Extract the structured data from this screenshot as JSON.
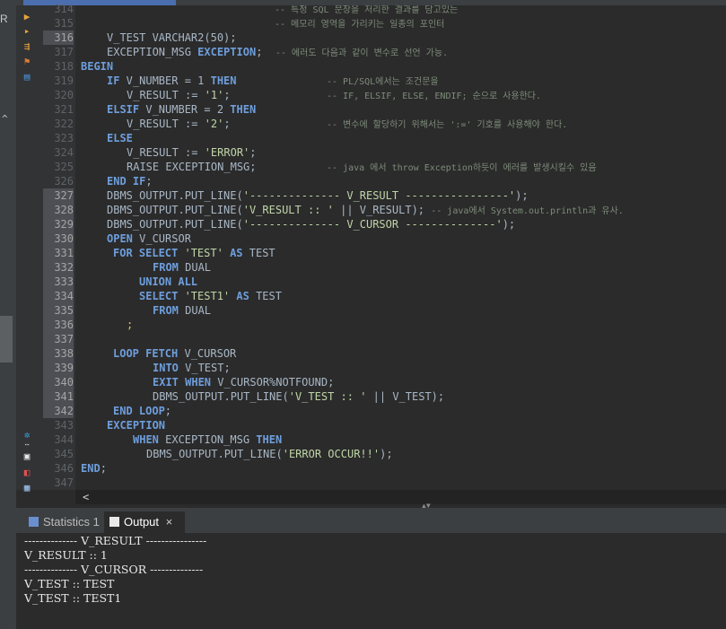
{
  "left_strip": {
    "label": "R"
  },
  "line_numbers": [
    "314",
    "315",
    "316",
    "317",
    "318",
    "319",
    "320",
    "321",
    "322",
    "323",
    "324",
    "325",
    "326",
    "327",
    "328",
    "329",
    "330",
    "331",
    "332",
    "333",
    "334",
    "335",
    "336",
    "337",
    "338",
    "339",
    "340",
    "341",
    "342",
    "343",
    "344",
    "345",
    "346",
    "347"
  ],
  "code": {
    "l314_c": "-- 특정 SQL 문장을 저리한 결과를 담고있는",
    "l315_c": "-- 메모리 영역을 가리키는 일종의 포인터",
    "l316_a": "V_TEST VARCHAR2(50);",
    "l317_a": "EXCEPTION_MSG ",
    "l317_k": "EXCEPTION",
    "l317_b": ";  ",
    "l317_c": "-- 에러도 다음과 같이 변수로 선언 가능.",
    "l318_k": "BEGIN",
    "l319_k1": "IF",
    "l319_a": " V_NUMBER = 1 ",
    "l319_k2": "THEN",
    "l319_c": "-- PL/SQL에서는 조건문을",
    "l320_a": "V_RESULT := ",
    "l320_s": "'1'",
    "l320_b": ";",
    "l320_c": "-- IF, ELSIF, ELSE, ENDIF; 순으로 사용한다.",
    "l321_k1": "ELSIF",
    "l321_a": " V_NUMBER = 2 ",
    "l321_k2": "THEN",
    "l322_a": "V_RESULT := ",
    "l322_s": "'2'",
    "l322_b": ";",
    "l322_c": "-- 변수에 할당하기 위해서는 ':=' 기호를 사용해야 한다.",
    "l323_k": "ELSE",
    "l324_a": "V_RESULT := ",
    "l324_s": "'ERROR'",
    "l324_b": ";",
    "l325_a": "RAISE EXCEPTION_MSG;",
    "l325_c": "-- java 에서 throw Exception하듯이 에러를 발생시킬수 있음",
    "l326_k": "END IF",
    "l326_b": ";",
    "l327_a": "DBMS_OUTPUT.PUT_LINE(",
    "l327_s": "'-------------- V_RESULT ----------------'",
    "l327_b": ");",
    "l328_a": "DBMS_OUTPUT.PUT_LINE(",
    "l328_s": "'V_RESULT :: '",
    "l328_b": " || V_RESULT); ",
    "l328_c": "-- java에서 System.out.println과 유사.",
    "l329_a": "DBMS_OUTPUT.PUT_LINE(",
    "l329_s": "'-------------- V_CURSOR --------------'",
    "l329_b": ");",
    "l330_k": "OPEN",
    "l330_a": " V_CURSOR",
    "l331_k1": "FOR SELECT ",
    "l331_s": "'TEST'",
    "l331_k2": " AS",
    "l331_a": " TEST",
    "l332_k": "FROM",
    "l332_a": " DUAL",
    "l333_k": "UNION ALL",
    "l334_k1": "SELECT ",
    "l334_s": "'TEST1'",
    "l334_k2": " AS",
    "l334_a": " TEST",
    "l335_k": "FROM",
    "l335_a": " DUAL",
    "l336_a": ";",
    "l338_k": "LOOP FETCH",
    "l338_a": " V_CURSOR",
    "l339_k": "INTO",
    "l339_a": " V_TEST;",
    "l340_k1": "EXIT WHEN",
    "l340_a": " V_CURSOR%NOTFOUND;",
    "l341_a": "DBMS_OUTPUT.PUT_LINE(",
    "l341_s": "'V_TEST :: '",
    "l341_b": " || V_TEST);",
    "l342_k": "END LOOP",
    "l342_b": ";",
    "l343_k": "EXCEPTION",
    "l344_k1": "WHEN",
    "l344_a": " EXCEPTION_MSG ",
    "l344_k2": "THEN",
    "l345_a": "DBMS_OUTPUT.PUT_LINE(",
    "l345_s": "'ERROR OCCUR!!'",
    "l345_b": ");",
    "l346_k": "END",
    "l346_b": ";"
  },
  "scrollbar": {
    "left_arrow": "<"
  },
  "panel_tabs": {
    "statistics": "Statistics 1",
    "output": "Output",
    "close": "×"
  },
  "output_lines": [
    "-------------- V_RESULT ----------------",
    "V_RESULT :: 1",
    "-------------- V_CURSOR --------------",
    "V_TEST :: TEST",
    "V_TEST :: TEST1"
  ],
  "colors": {
    "keyword": "#6e9edc",
    "string": "#c0d5a8",
    "comment": "#7d8c7a",
    "text": "#a9b7c6",
    "background": "#2b2b2b"
  }
}
